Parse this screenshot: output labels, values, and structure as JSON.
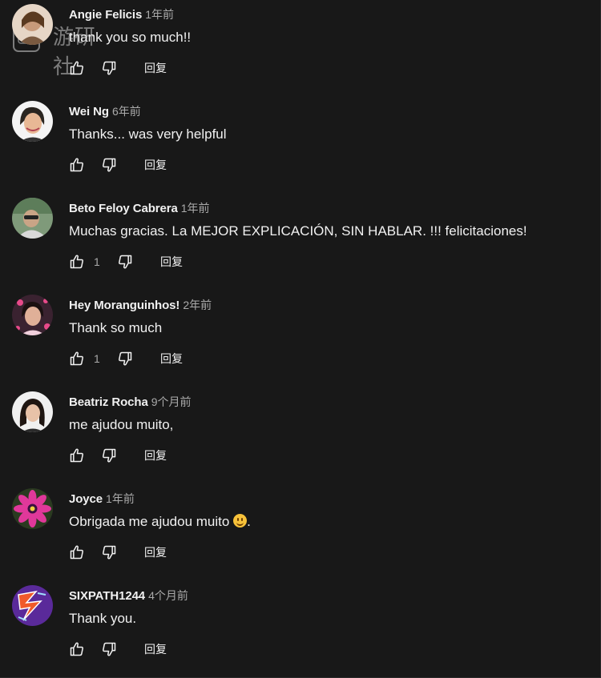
{
  "watermark": {
    "text": "游研社"
  },
  "comments": [
    {
      "author": "Angie Felicis",
      "time": "1年前",
      "text": "thank you so much!!",
      "likes": "",
      "reply": "回复",
      "avatar": "avatar-angie-icon"
    },
    {
      "author": "Wei Ng",
      "time": "6年前",
      "text": "Thanks... was very helpful",
      "likes": "",
      "reply": "回复",
      "avatar": "avatar-wei-icon"
    },
    {
      "author": "Beto Feloy Cabrera",
      "time": "1年前",
      "text": "Muchas gracias. La MEJOR EXPLICACIÓN, SIN HABLAR. !!! felicitaciones!",
      "likes": "1",
      "reply": "回复",
      "avatar": "avatar-beto-icon"
    },
    {
      "author": "Hey Moranguinhos!",
      "time": "2年前",
      "text": "Thank so much",
      "likes": "1",
      "reply": "回复",
      "avatar": "avatar-hey-icon"
    },
    {
      "author": "Beatriz Rocha",
      "time": "9个月前",
      "text": "me ajudou muito,",
      "likes": "",
      "reply": "回复",
      "avatar": "avatar-beatriz-icon"
    },
    {
      "author": "Joyce",
      "time": "1年前",
      "text": "Obrigada me ajudou muito",
      "text_suffix": ".",
      "likes": "",
      "reply": "回复",
      "avatar": "avatar-joyce-icon"
    },
    {
      "author": "SIXPATH1244",
      "time": "4个月前",
      "text": "Thank you.",
      "likes": "",
      "reply": "回复",
      "avatar": "avatar-sixpath-icon"
    }
  ],
  "colors": {
    "background": "#181818",
    "text_primary": "#f1f1f1",
    "text_secondary": "#aaaaaa"
  }
}
